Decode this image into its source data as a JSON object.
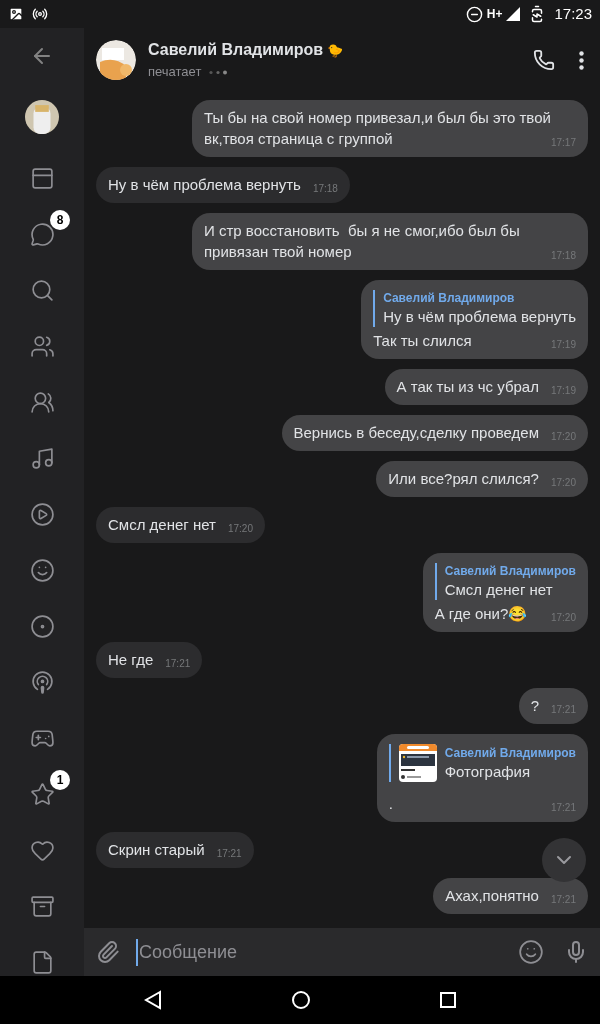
{
  "status_bar": {
    "network": "H+",
    "time": "17:23"
  },
  "header": {
    "name": "Савелий Владимиров",
    "name_emoji": "🐤",
    "status": "печатает"
  },
  "sidebar": {
    "badges": [
      "8",
      "1"
    ]
  },
  "messages": [
    {
      "kind": "text",
      "outgoing": true,
      "text": "Ты бы на свой номер привезал,и был бы это твой вк,твоя страница с группой",
      "time": "17:17"
    },
    {
      "kind": "text",
      "outgoing": false,
      "text": "Ну в чём проблема вернуть",
      "time": "17:18"
    },
    {
      "kind": "text",
      "outgoing": true,
      "text": "И стр восстановить  бы я не смог,ибо был бы привязан твой номер",
      "time": "17:18"
    },
    {
      "kind": "reply",
      "outgoing": true,
      "reply_author": "Савелий Владимиров",
      "reply_text": "Ну в чём проблема вернуть",
      "text": "Так ты слился",
      "time": "17:19"
    },
    {
      "kind": "text",
      "outgoing": true,
      "text": "А так ты из чс убрал",
      "time": "17:19"
    },
    {
      "kind": "text",
      "outgoing": true,
      "text": "Вернись в беседу,сделку проведем",
      "time": "17:20"
    },
    {
      "kind": "text",
      "outgoing": true,
      "text": "Или все?рял слился?",
      "time": "17:20"
    },
    {
      "kind": "text",
      "outgoing": false,
      "text": "Смсл денег нет",
      "time": "17:20"
    },
    {
      "kind": "reply",
      "outgoing": true,
      "reply_author": "Савелий Владимиров",
      "reply_text": "Смсл денег нет",
      "text": "А где они?😂",
      "time": "17:20"
    },
    {
      "kind": "text",
      "outgoing": false,
      "text": "Не где",
      "time": "17:21"
    },
    {
      "kind": "text",
      "outgoing": true,
      "text": "?",
      "time": "17:21"
    },
    {
      "kind": "photo_reply",
      "outgoing": true,
      "reply_author": "Савелий Владимиров",
      "reply_text": "Фотография",
      "text": ".",
      "time": "17:21"
    },
    {
      "kind": "text",
      "outgoing": false,
      "text": "Скрин старый",
      "time": "17:21"
    },
    {
      "kind": "text",
      "outgoing": true,
      "text": "Ахах,понятно",
      "time": "17:21"
    }
  ],
  "composer": {
    "placeholder": "Сообщение"
  }
}
